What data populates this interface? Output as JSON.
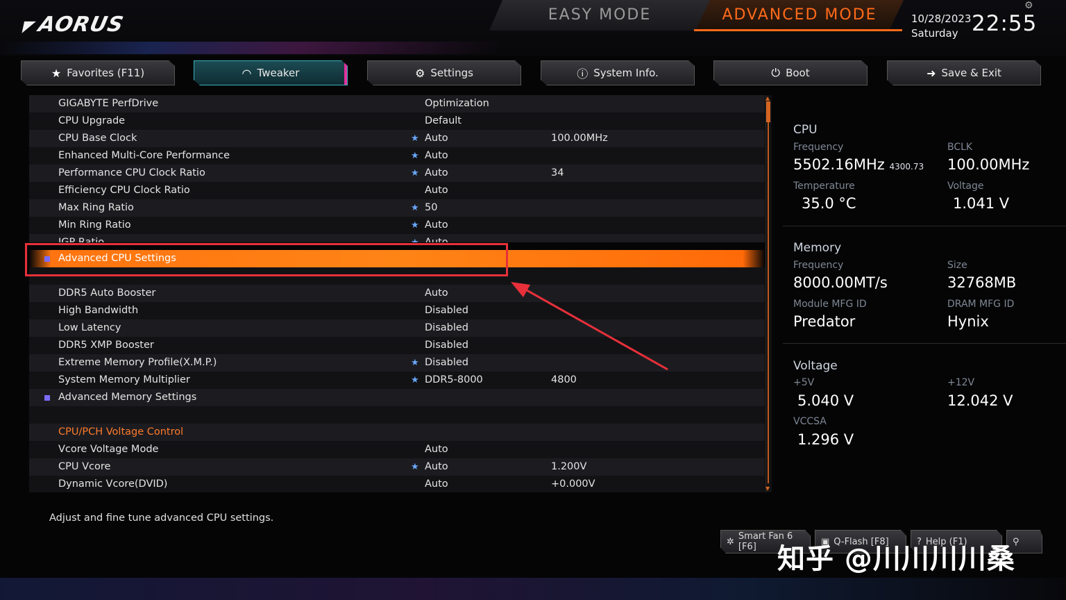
{
  "brand": {
    "logo_text": "AORUS"
  },
  "modes": {
    "easy": "EASY MODE",
    "advanced": "ADVANCED MODE"
  },
  "datetime": {
    "date": "10/28/2023",
    "day": "Saturday",
    "time": "22:55"
  },
  "tabs": [
    {
      "label": "Favorites (F11)",
      "icon": "star-box-icon"
    },
    {
      "label": "Tweaker",
      "icon": "gauge-icon",
      "active": true
    },
    {
      "label": "Settings",
      "icon": "gear-icon"
    },
    {
      "label": "System Info.",
      "icon": "info-icon"
    },
    {
      "label": "Boot",
      "icon": "power-icon"
    },
    {
      "label": "Save & Exit",
      "icon": "exit-icon"
    }
  ],
  "settings": [
    {
      "label": "GIGABYTE PerfDrive",
      "value": "Optimization",
      "value2": "",
      "star": false
    },
    {
      "label": "CPU Upgrade",
      "value": "Default",
      "value2": "",
      "star": false
    },
    {
      "label": "CPU Base Clock",
      "value": "Auto",
      "value2": "100.00MHz",
      "star": true
    },
    {
      "label": "Enhanced Multi-Core Performance",
      "value": "Auto",
      "value2": "",
      "star": true
    },
    {
      "label": "Performance CPU Clock Ratio",
      "value": "Auto",
      "value2": "34",
      "star": true
    },
    {
      "label": "Efficiency CPU Clock Ratio",
      "value": "Auto",
      "value2": "",
      "star": false
    },
    {
      "label": "Max Ring Ratio",
      "value": "50",
      "value2": "",
      "star": true
    },
    {
      "label": "Min Ring Ratio",
      "value": "Auto",
      "value2": "",
      "star": true
    },
    {
      "label": "IGP Ratio",
      "value": "Auto",
      "value2": "",
      "star": true
    },
    {
      "label": "Advanced CPU Settings",
      "value": "",
      "value2": "",
      "star": false
    },
    {
      "label": "DDR5 Auto Booster",
      "value": "Auto",
      "value2": "",
      "star": false
    },
    {
      "label": "High Bandwidth",
      "value": "Disabled",
      "value2": "",
      "star": false
    },
    {
      "label": "Low Latency",
      "value": "Disabled",
      "value2": "",
      "star": false
    },
    {
      "label": "DDR5 XMP Booster",
      "value": "Disabled",
      "value2": "",
      "star": false
    },
    {
      "label": "Extreme Memory Profile(X.M.P.)",
      "value": "Disabled",
      "value2": "",
      "star": true
    },
    {
      "label": "System Memory Multiplier",
      "value": "DDR5-8000",
      "value2": "4800",
      "star": true
    },
    {
      "label": "Advanced Memory Settings",
      "value": "",
      "value2": "",
      "star": false
    },
    {
      "label": "CPU/PCH Voltage Control",
      "value": "",
      "value2": "",
      "star": false
    },
    {
      "label": "Vcore Voltage Mode",
      "value": "Auto",
      "value2": "",
      "star": false
    },
    {
      "label": "CPU Vcore",
      "value": "Auto",
      "value2": "1.200V",
      "star": true
    },
    {
      "label": "Dynamic Vcore(DVID)",
      "value": "Auto",
      "value2": "+0.000V",
      "star": false
    }
  ],
  "panel": {
    "cpu": {
      "title": "CPU",
      "freq_label": "Frequency",
      "freq": "5502.16MHz",
      "freq_sub": "4300.73",
      "bclk_label": "BCLK",
      "bclk": "100.00MHz",
      "temp_label": "Temperature",
      "temp": "35.0 °C",
      "volt_label": "Voltage",
      "volt": "1.041 V"
    },
    "memory": {
      "title": "Memory",
      "freq_label": "Frequency",
      "freq": "8000.00MT/s",
      "size_label": "Size",
      "size": "32768MB",
      "module_label": "Module MFG ID",
      "module": "Predator",
      "dram_label": "DRAM MFG ID",
      "dram": "Hynix"
    },
    "voltage": {
      "title": "Voltage",
      "v5_label": "+5V",
      "v5": "5.040 V",
      "v12_label": "+12V",
      "v12": "12.042 V",
      "vccsa_label": "VCCSA",
      "vccsa": "1.296 V"
    }
  },
  "help_text": "Adjust and fine tune advanced CPU settings.",
  "bottom_buttons": {
    "smartfan": "Smart Fan 6 [F6]",
    "qflash": "Q-Flash [F8]",
    "help": "Help (F1)"
  },
  "watermark": "知乎 @川川川川桑",
  "colors": {
    "accent": "#ff6a1a",
    "highlight": "#ff7a12",
    "annotation": "#e8303a",
    "active_tab": "#1c4b54"
  }
}
